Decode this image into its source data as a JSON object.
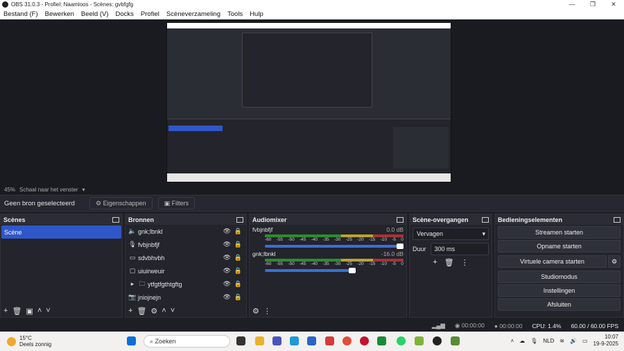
{
  "window": {
    "title": "OBS 31.0.3 - Profiel: Naamloos - Scènes: gvbfgfg"
  },
  "menu": [
    "Bestand (F)",
    "Bewerken",
    "Beeld (V)",
    "Docks",
    "Profiel",
    "Scèneverzameling",
    "Tools",
    "Hulp"
  ],
  "zoom": {
    "percent": "45%",
    "mode": "Schaal naar het venster"
  },
  "source_bar": {
    "status": "Geen bron geselecteerd",
    "properties": "Eigenschappen",
    "filters": "Filters"
  },
  "scenes": {
    "title": "Scènes",
    "items": [
      "Scène"
    ]
  },
  "sources": {
    "title": "Bronnen",
    "items": [
      {
        "name": "gnk;lbnkl",
        "icon": "speaker-icon"
      },
      {
        "name": "fvbjnbfjf",
        "icon": "mic-icon"
      },
      {
        "name": "sdvbhvbh",
        "icon": "monitor-icon"
      },
      {
        "name": "uiuirweuir",
        "icon": "window-icon"
      },
      {
        "name": "ytfgtfgthtgftg",
        "icon": "folder-icon"
      },
      {
        "name": "jniojnejn",
        "icon": "camera-icon"
      }
    ]
  },
  "mixer": {
    "title": "Audiomixer",
    "tracks": [
      {
        "name": "fvbjnbfjf",
        "db": "0.0 dB",
        "level": 0.95
      },
      {
        "name": "gnk;lbnkl",
        "db": "-16.0 dB",
        "level": 0.55
      }
    ],
    "scale": [
      "-60",
      "-55",
      "-50",
      "-45",
      "-40",
      "-35",
      "-30",
      "-25",
      "-20",
      "-15",
      "-10",
      "-5",
      "0"
    ]
  },
  "transitions": {
    "title": "Scène-overgangen",
    "type": "Vervagen",
    "duration_label": "Duur",
    "duration": "300 ms"
  },
  "controls": {
    "title": "Bedieningselementen",
    "buttons": [
      "Streamen starten",
      "Opname starten",
      "Virtuele camera starten",
      "Studiomodus",
      "Instellingen",
      "Afsluiten"
    ]
  },
  "status": {
    "stream_time": "00:00:00",
    "rec_time": "00:00:00",
    "cpu": "CPU: 1.4%",
    "fps": "60.00 / 60.00 FPS"
  },
  "taskbar": {
    "temp": "15°C",
    "weather": "Deels zonnig",
    "search": "Zoeken",
    "lang": "NLD",
    "time": "10:07",
    "date": "19-9-2025"
  }
}
